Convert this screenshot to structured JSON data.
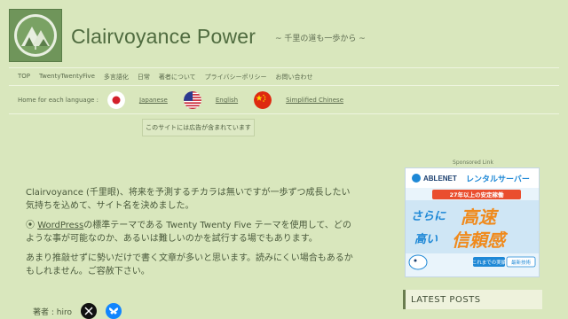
{
  "site": {
    "title": "Clairvoyance Power",
    "tagline": "~ 千里の道も一歩から ~"
  },
  "nav": {
    "items": [
      "TOP",
      "TwentyTwentyFive",
      "多言語化",
      "日常",
      "著者について",
      "プライバシーポリシー",
      "お問い合わせ"
    ]
  },
  "languages": {
    "label": "Home for each language :",
    "items": [
      {
        "label": "Japanese",
        "flag": "japan-flag-icon"
      },
      {
        "label": "English",
        "flag": "usa-flag-icon"
      },
      {
        "label": "Simplified Chinese",
        "flag": "china-flag-icon"
      }
    ]
  },
  "ad_notice": "このサイトには広告が含まれています",
  "main": {
    "p1": "Clairvoyance (千里眼)、将来を予測するチカラは無いですが一歩ずつ成長したい気持ちを込めて、サイト名を決めました。",
    "p2_prefix": "WordPress",
    "p2_rest": "の標準テーマである Twenty Twenty Five テーマを使用して、どのような事が可能なのか、あるいは難しいのかを試行する場でもあります。",
    "p3": "あまり推敲せずに勢いだけで書く文章が多いと思います。読みにくい場合もあるかもしれません。ご容赦下さい。",
    "author": "著者 : hiro"
  },
  "sidebar": {
    "sponsored": "Sponsored Link",
    "banner": {
      "brand": "ABLENET",
      "product": "レンタルサーバー",
      "badge": "27年以上の安定稼働",
      "line1a": "さらに",
      "line1b": "高速",
      "line2a": "高い",
      "line2b": "信頼感",
      "footer1": "これまでの実績",
      "footer2": "最新技術"
    },
    "latest_posts": "LATEST POSTS"
  },
  "colors": {
    "background": "#d9e7bd",
    "accent": "#4f6b3f",
    "banner_blue": "#1e88d6",
    "banner_orange": "#f08a1c"
  }
}
